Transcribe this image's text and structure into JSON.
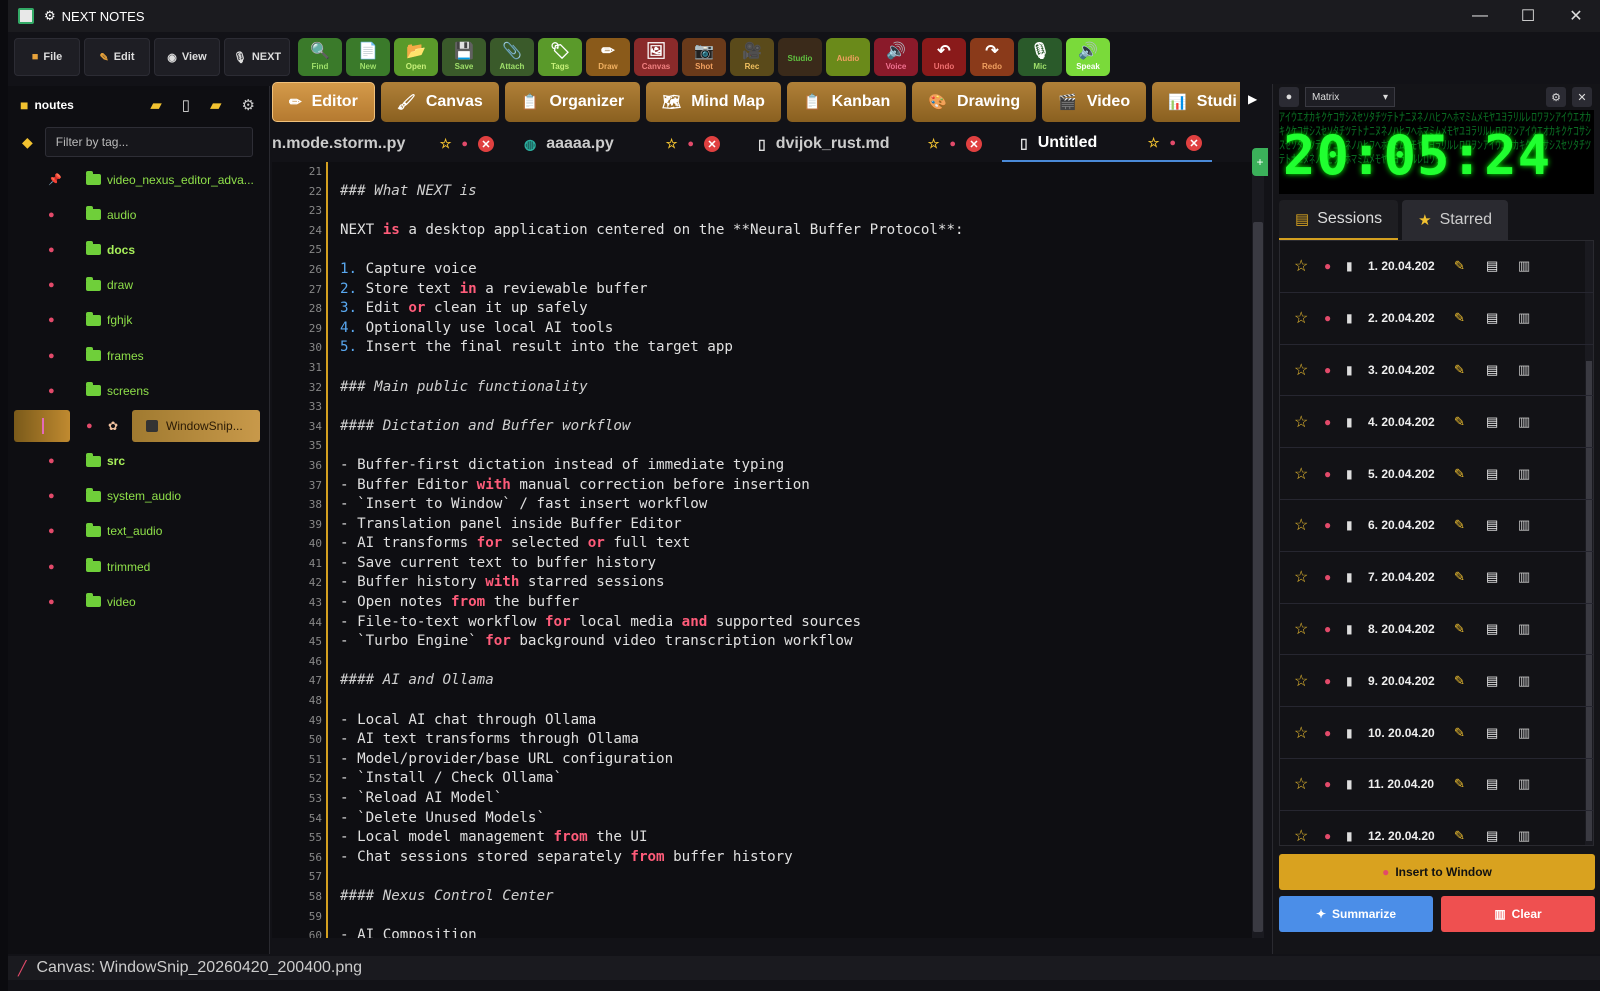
{
  "window": {
    "title": "NEXT NOTES"
  },
  "colors": {
    "accent": "#d4a020",
    "keyword": "#ff5c7a",
    "folder": "#6fcf3a",
    "clock": "#20ff30"
  },
  "menu": [
    {
      "label": "File",
      "icon": "folder-icon"
    },
    {
      "label": "Edit",
      "icon": "pencil-icon"
    },
    {
      "label": "View",
      "icon": "eye-icon"
    },
    {
      "label": "NEXT",
      "icon": "mic-icon"
    }
  ],
  "tools": [
    {
      "label": "Find",
      "glyph": "🔍",
      "bg": "#3a7a2a",
      "fg": "#9fe06a"
    },
    {
      "label": "New",
      "glyph": "📄",
      "bg": "#3a7a2a",
      "fg": "#9fe06a"
    },
    {
      "label": "Open",
      "glyph": "📂",
      "bg": "#5a9a2a",
      "fg": "#c8f07a"
    },
    {
      "label": "Save",
      "glyph": "💾",
      "bg": "#3a5a2a",
      "fg": "#9fe06a"
    },
    {
      "label": "Attach",
      "glyph": "📎",
      "bg": "#3a5a2a",
      "fg": "#9fe06a"
    },
    {
      "label": "Tags",
      "glyph": "🏷",
      "bg": "#5a9a2a",
      "fg": "#c8f07a"
    },
    {
      "label": "Draw",
      "glyph": "✏",
      "bg": "#8a5a1a",
      "fg": "#f0b060"
    },
    {
      "label": "Canvas",
      "glyph": "🖼",
      "bg": "#8a2a2a",
      "fg": "#f08080"
    },
    {
      "label": "Shot",
      "glyph": "📷",
      "bg": "#6a3a1a",
      "fg": "#f0a060"
    },
    {
      "label": "Rec",
      "glyph": "🎥",
      "bg": "#5a4a1a",
      "fg": "#f0c060"
    },
    {
      "label": "Studio",
      "glyph": "",
      "bg": "#3a2a1a",
      "fg": "#60c040"
    },
    {
      "label": "Audio",
      "glyph": "",
      "bg": "#6a8a1a",
      "fg": "#f0a060"
    },
    {
      "label": "Voice",
      "glyph": "🔊",
      "bg": "#8a1a2a",
      "fg": "#f07090"
    },
    {
      "label": "Undo",
      "glyph": "↶",
      "bg": "#8a1a1a",
      "fg": "#f07070"
    },
    {
      "label": "Redo",
      "glyph": "↷",
      "bg": "#8a3a1a",
      "fg": "#f0a060"
    },
    {
      "label": "Mic",
      "glyph": "🎙",
      "bg": "#2a5a2a",
      "fg": "#9fe06a"
    },
    {
      "label": "Speak",
      "glyph": "🔊",
      "bg": "#7ada3a",
      "fg": "#ffffff"
    }
  ],
  "sidebar": {
    "root": "noutes",
    "filter_placeholder": "Filter by tag...",
    "items": [
      {
        "label": "video_nexus_editor_adva..."
      },
      {
        "label": "audio"
      },
      {
        "label": "docs"
      },
      {
        "label": "draw"
      },
      {
        "label": "fghjk"
      },
      {
        "label": "frames"
      },
      {
        "label": "screens"
      },
      {
        "label": "WindowSnip..."
      },
      {
        "label": "src"
      },
      {
        "label": "system_audio"
      },
      {
        "label": "text_audio"
      },
      {
        "label": "trimmed"
      },
      {
        "label": "video"
      }
    ]
  },
  "view_tabs": [
    {
      "label": "Editor",
      "glyph": "✏"
    },
    {
      "label": "Canvas",
      "glyph": "🖌"
    },
    {
      "label": "Organizer",
      "glyph": "📋"
    },
    {
      "label": "Mind Map",
      "glyph": "🗺"
    },
    {
      "label": "Kanban",
      "glyph": "📋"
    },
    {
      "label": "Drawing",
      "glyph": "🎨"
    },
    {
      "label": "Video",
      "glyph": "🎬"
    },
    {
      "label": "Studi",
      "glyph": "📊"
    }
  ],
  "file_tabs": [
    {
      "label": "n.mode.storm..py"
    },
    {
      "label": "aaaaa.py"
    },
    {
      "label": "dvijok_rust.md"
    },
    {
      "label": "Untitled"
    }
  ],
  "editor": {
    "line_numbers": [
      "21",
      "22",
      "23",
      "24",
      "25",
      "26",
      "27",
      "28",
      "29",
      "30",
      "31",
      "32",
      "33",
      "34",
      "35",
      "36",
      "37",
      "38",
      "39",
      "40",
      "41",
      "42",
      "43",
      "44",
      "45",
      "46",
      "47",
      "48",
      "49",
      "50",
      "51",
      "52",
      "53",
      "54",
      "55",
      "56",
      "57",
      "58",
      "59",
      "60"
    ],
    "lines": [
      "",
      "### What NEXT is",
      "",
      "NEXT is a desktop application centered on the **Neural Buffer Protocol**:",
      "",
      "1. Capture voice",
      "2. Store text in a reviewable buffer",
      "3. Edit or clean it up safely",
      "4. Optionally use local AI tools",
      "5. Insert the final result into the target app",
      "",
      "### Main public functionality",
      "",
      "#### Dictation and Buffer workflow",
      "",
      "- Buffer-first dictation instead of immediate typing",
      "- Buffer Editor with manual correction before insertion",
      "- `Insert to Window` / fast insert workflow",
      "- Translation panel inside Buffer Editor",
      "- AI transforms for selected or full text",
      "- Save current text to buffer history",
      "- Buffer history with starred sessions",
      "- Open notes from the buffer",
      "- File-to-text workflow for local media and supported sources",
      "- `Turbo Engine` for background video transcription workflow",
      "",
      "#### AI and Ollama",
      "",
      "- Local AI chat through Ollama",
      "- AI text transforms through Ollama",
      "- Model/provider/base URL configuration",
      "- `Install / Check Ollama`",
      "- `Reload AI Model`",
      "- `Delete Unused Models`",
      "- Local model management from the UI",
      "- Chat sessions stored separately from buffer history",
      "",
      "#### Nexus Control Center",
      "",
      "- AI Composition"
    ]
  },
  "right_panel": {
    "mode": "Matrix",
    "clock": "20:05:24",
    "tabs": [
      {
        "label": "Sessions"
      },
      {
        "label": "Starred"
      }
    ],
    "sessions": [
      "1. 20.04.202",
      "2. 20.04.202",
      "3. 20.04.202",
      "4. 20.04.202",
      "5. 20.04.202",
      "6. 20.04.202",
      "7. 20.04.202",
      "8. 20.04.202",
      "9. 20.04.202",
      "10. 20.04.20",
      "11. 20.04.20",
      "12. 20.04.20"
    ],
    "insert_label": "Insert to Window",
    "summarize_label": "Summarize",
    "clear_label": "Clear"
  },
  "status": {
    "text": "Canvas: WindowSnip_20260420_200400.png"
  }
}
